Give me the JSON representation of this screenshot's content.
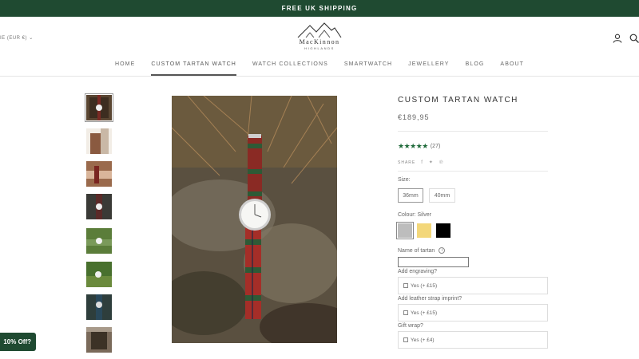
{
  "announcement": "FREE UK SHIPPING",
  "header": {
    "currency": "IE (EUR €)",
    "logo_name": "MacKinnon",
    "logo_sub": "HIGHLANDS",
    "account_icon": "user-icon",
    "search_icon": "search-icon"
  },
  "nav": {
    "items": [
      "HOME",
      "CUSTOM TARTAN WATCH",
      "WATCH COLLECTIONS",
      "SMARTWATCH",
      "JEWELLERY",
      "BLOG",
      "ABOUT"
    ],
    "active": "CUSTOM TARTAN WATCH"
  },
  "product": {
    "title": "CUSTOM TARTAN WATCH",
    "price": "€189,95",
    "stars": "★★★★★",
    "rating": 5,
    "review_count": "(27)",
    "share_label": "SHARE",
    "share_icons": [
      "facebook-icon",
      "twitter-icon",
      "pinterest-icon"
    ],
    "share_glyphs": [
      "f",
      "✦",
      "℗"
    ]
  },
  "options": {
    "size_label": "Size:",
    "sizes": [
      "36mm",
      "40mm"
    ],
    "selected_size": "36mm",
    "colour_label": "Colour: Silver",
    "colours": [
      {
        "name": "Silver",
        "hex": "#bdbdbd"
      },
      {
        "name": "Gold",
        "hex": "#f3d77a"
      },
      {
        "name": "Black",
        "hex": "#000000"
      }
    ],
    "selected_colour": "Silver",
    "tartan_label": "Name of tartan",
    "tartan_info_icon": "info-icon",
    "tartan_value": "",
    "engraving_label": "Add engraving?",
    "engraving_option": "Yes (+ £15)",
    "imprint_label": "Add leather strap imprint?",
    "imprint_option": "Yes (+ £15)",
    "giftwrap_label": "Gift wrap?",
    "giftwrap_option": "Yes (+ £4)"
  },
  "discount_tab": "10% Off?",
  "colors": {
    "brand_green": "#1f4a31",
    "star_green": "#1f6a3a"
  }
}
